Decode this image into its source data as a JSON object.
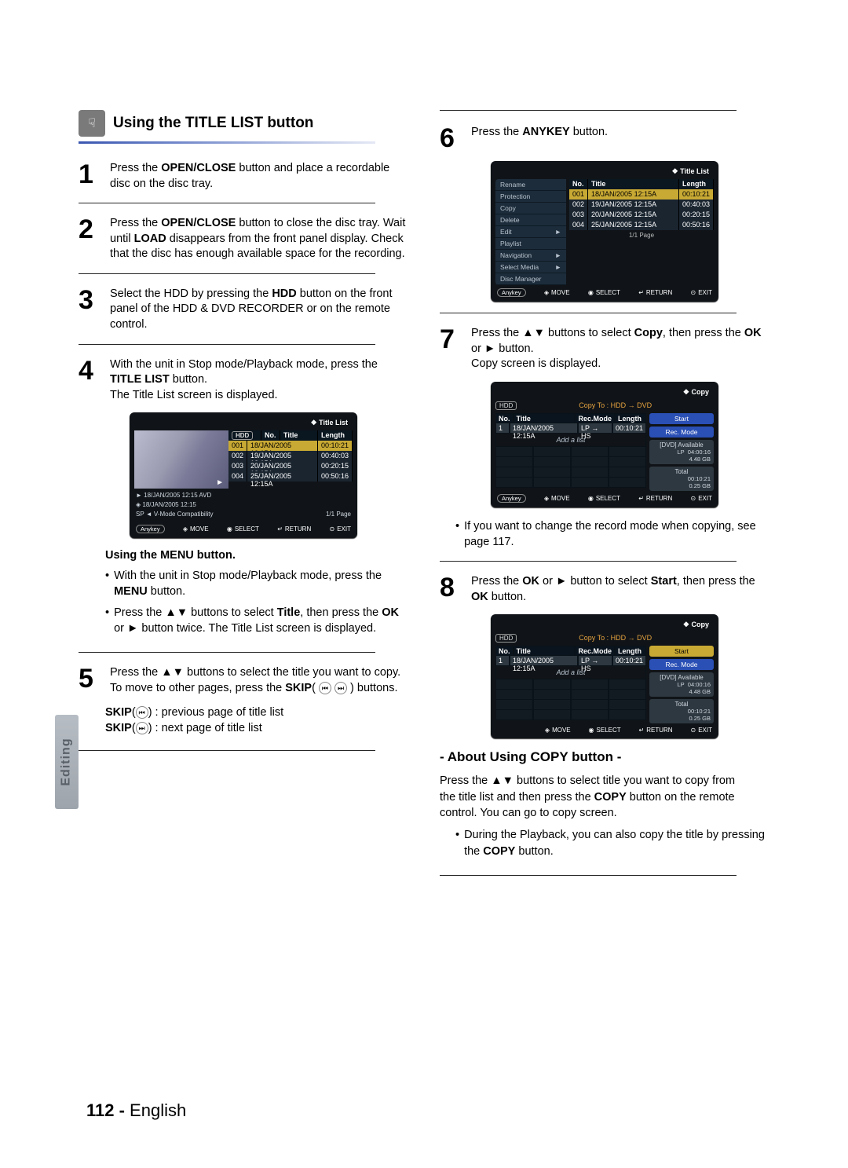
{
  "side_tab": "Editing",
  "page_number_prefix": "112 - ",
  "page_number_lang": "English",
  "left": {
    "head_title": "Using the TITLE LIST button",
    "step1": {
      "pre": "Press the ",
      "b1": "OPEN/CLOSE",
      "post": " button and place a recordable disc on the disc tray."
    },
    "step2": {
      "pre": "Press the ",
      "b1": "OPEN/CLOSE",
      "mid": " button to close the disc tray. Wait until ",
      "b2": "LOAD",
      "post": " disappears from the front panel display. Check that the disc has enough available space for the recording."
    },
    "step3": {
      "pre": "Select the HDD by pressing the ",
      "b1": "HDD",
      "post": " button on the front panel of the HDD & DVD RECORDER or on the remote control."
    },
    "step4": {
      "pre": "With the unit in Stop mode/Playback mode, press the ",
      "b1": "TITLE LIST",
      "post": " button.",
      "tail": "The Title List screen is displayed."
    },
    "osd": {
      "header": "Title List",
      "hdd": "HDD",
      "cols": {
        "no": "No.",
        "title": "Title",
        "length": "Length"
      },
      "rows": [
        {
          "no": "001",
          "title": "18/JAN/2005 12:15A",
          "len": "00:10:21"
        },
        {
          "no": "002",
          "title": "19/JAN/2005 12:15A",
          "len": "00:40:03"
        },
        {
          "no": "003",
          "title": "20/JAN/2005 12:15A",
          "len": "00:20:15"
        },
        {
          "no": "004",
          "title": "25/JAN/2005 12:15A",
          "len": "00:50:16"
        }
      ],
      "info1": "► 18/JAN/2005 12:15 AVD",
      "info2": "◈ 18/JAN/2005 12:15",
      "info3": "SP ◄ V-Mode Compatibility",
      "page": "1/1 Page",
      "anykey": "Anykey",
      "move_label": "MOVE",
      "select_label": "SELECT",
      "return_label": "RETURN",
      "exit_label": "EXIT"
    },
    "menu_sub_head": "Using the MENU button.",
    "menu_b1_pre": "With the unit in Stop mode/Playback mode, press the ",
    "menu_b1_b": "MENU",
    "menu_b1_post": " button.",
    "menu_b2_pre": "Press the ",
    "menu_b2_arrows": "▲▼",
    "menu_b2_mid": " buttons to select ",
    "menu_b2_b1": "Title",
    "menu_b2_mid2": ", then press the ",
    "menu_b2_b2": "OK",
    "menu_b2_mid3": " or ",
    "menu_b2_play": "►",
    "menu_b2_post": " button twice. The Title List screen is displayed.",
    "step5": {
      "pre": "Press the ",
      "arrows": "▲▼",
      "post": " buttons to select the title you want to copy.",
      "move_pre": "To move to other pages, press the ",
      "move_b": "SKIP",
      "move_post": " buttons.",
      "skip_prev_b": "SKIP",
      "skip_prev_post": " : previous page of title list",
      "skip_next_b": "SKIP",
      "skip_next_post": " : next page of title list"
    }
  },
  "right": {
    "step6": {
      "pre": "Press the ",
      "b1": "ANYKEY",
      "post": " button."
    },
    "osd_menu": {
      "header": "Title List",
      "menu": [
        "Rename",
        "Protection",
        "Copy",
        "Delete",
        "Edit",
        "Playlist",
        "Navigation",
        "Select Media",
        "Disc Manager"
      ],
      "submenu_arrow": "►",
      "cols": {
        "no": "No.",
        "title": "Title",
        "length": "Length"
      },
      "rows": [
        {
          "no": "001",
          "title": "18/JAN/2005 12:15A",
          "len": "00:10:21"
        },
        {
          "no": "002",
          "title": "19/JAN/2005 12:15A",
          "len": "00:40:03"
        },
        {
          "no": "003",
          "title": "20/JAN/2005 12:15A",
          "len": "00:20:15"
        },
        {
          "no": "004",
          "title": "25/JAN/2005 12:15A",
          "len": "00:50:16"
        }
      ],
      "page": "1/1 Page",
      "anykey": "Anykey",
      "move_label": "MOVE",
      "select_label": "SELECT",
      "return_label": "RETURN",
      "exit_label": "EXIT"
    },
    "step7": {
      "pre": "Press the ",
      "arrows": "▲▼",
      "mid": " buttons to select ",
      "b1": "Copy",
      "mid2": ", then press the ",
      "b2": "OK",
      "mid3": " or ",
      "play": "►",
      "post": " button.",
      "tail": "Copy screen is displayed."
    },
    "copy1": {
      "header": "Copy",
      "hdd": "HDD",
      "copy_to": "Copy To : HDD → DVD",
      "cols": {
        "no": "No.",
        "title": "Title",
        "rec": "Rec.Mode",
        "len": "Length"
      },
      "row": {
        "no": "1",
        "title": "18/JAN/2005 12:15A",
        "rec": "LP → HS",
        "len": "00:10:21"
      },
      "add": "Add a list",
      "start": "Start",
      "recmode": "Rec. Mode",
      "avail": "[DVD] Available",
      "lp": "LP",
      "lp_time": "04:00:16",
      "size": "4.48 GB",
      "total": "Total",
      "total_time": "00:10:21",
      "total_gb": "0.25 GB",
      "anykey": "Anykey",
      "move_label": "MOVE",
      "select_label": "SELECT",
      "return_label": "RETURN",
      "exit_label": "EXIT"
    },
    "note_mode": "If you want to change the record mode when copying, see page 117.",
    "step8": {
      "pre": "Press the ",
      "b1": "OK",
      "mid": " or ",
      "play": "►",
      "mid2": " button to select ",
      "b2": "Start",
      "mid3": ", then press the ",
      "b3": "OK",
      "post": " button."
    },
    "copysub_title": "- About Using COPY button -",
    "copy_para_pre": "Press the ",
    "copy_para_arrows": "▲▼",
    "copy_para_mid": " buttons to select title you want to copy from the title list and then press the ",
    "copy_para_b": "COPY",
    "copy_para_post": " button on the remote control. You can go to copy screen.",
    "copy_bullet_pre": "During the Playback, you can also copy the title by pressing the ",
    "copy_bullet_b": "COPY",
    "copy_bullet_post": " button."
  }
}
